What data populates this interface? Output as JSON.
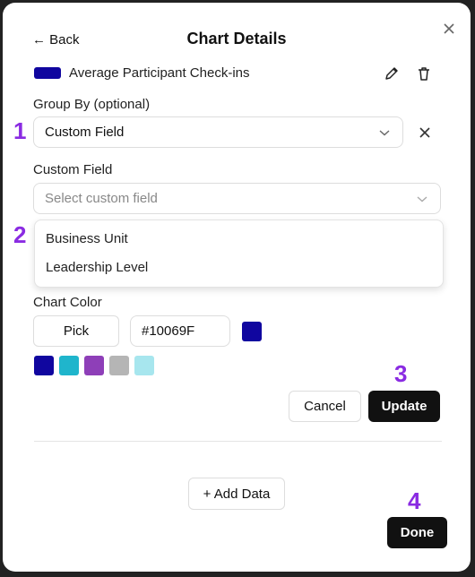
{
  "modal": {
    "title": "Chart Details",
    "back_label": "← Back",
    "close_icon": "×"
  },
  "series": {
    "name": "Average Participant Check-ins",
    "color": "#10069F"
  },
  "group_by": {
    "label": "Group By (optional)",
    "value": "Custom Field"
  },
  "custom_field": {
    "label": "Custom Field",
    "placeholder": "Select custom field",
    "options": [
      "Business Unit",
      "Leadership Level"
    ]
  },
  "chart_color": {
    "label": "Chart Color",
    "pick_label": "Pick",
    "hex_value": "#10069F",
    "presets": [
      "#10069F",
      "#1FB5CC",
      "#8E3FB8",
      "#B5B5B5",
      "#A7E6EE"
    ]
  },
  "actions": {
    "cancel_label": "Cancel",
    "update_label": "Update",
    "add_data_label": "+ Add Data",
    "done_label": "Done"
  },
  "annotations": {
    "step1": "1",
    "step2": "2",
    "step3": "3",
    "step4": "4"
  }
}
